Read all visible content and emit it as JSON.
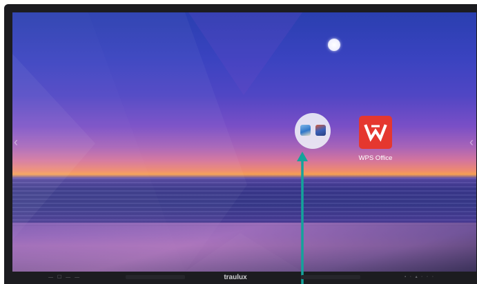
{
  "desktop": {
    "apps": [
      {
        "label": "",
        "icon": "app-folder-icon"
      },
      {
        "label": "WPS Office",
        "icon": "wps-office-icon"
      }
    ],
    "folder": {
      "apps": [
        "gallery-app-icon",
        "avatar-app-icon"
      ]
    }
  },
  "bezel": {
    "brand": "traulux",
    "nav_symbols": "— ☐ — —",
    "port_symbols": "▪ ◦ ▴ ◦ ◦ ◦"
  },
  "colors": {
    "wps_brand": "#e5372f",
    "drag_arrow": "#13a39b",
    "bezel": "#1c1c20"
  },
  "annotation": {
    "type": "drag-arrow",
    "direction": "up",
    "target": "app-folder"
  }
}
